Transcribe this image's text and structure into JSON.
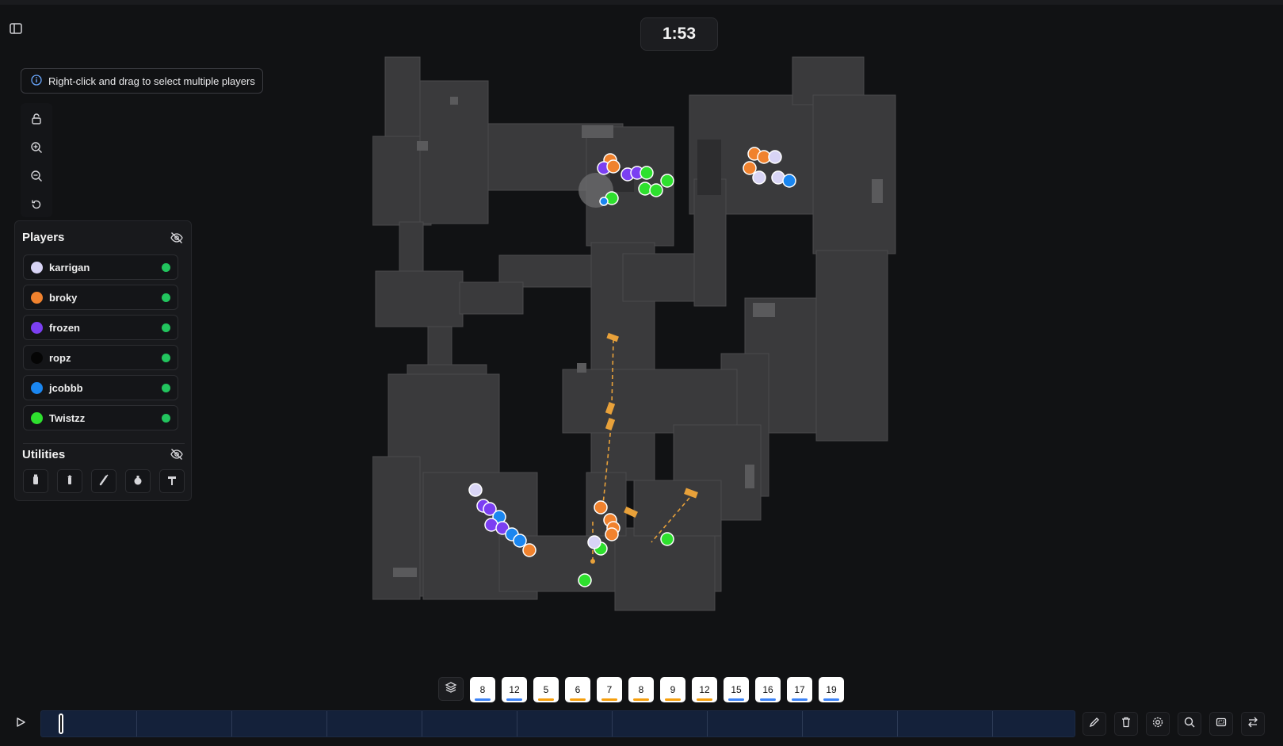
{
  "timer": "1:53",
  "hint": {
    "icon": "info-icon",
    "text": "Right-click and drag to select multiple players"
  },
  "tools": [
    "unlock-icon",
    "zoom-in-icon",
    "zoom-out-icon",
    "reset-icon"
  ],
  "players_panel": {
    "title": "Players",
    "items": [
      {
        "name": "karrigan",
        "color": "#d8d4f5"
      },
      {
        "name": "broky",
        "color": "#f0822e"
      },
      {
        "name": "frozen",
        "color": "#7b3ff2"
      },
      {
        "name": "ropz",
        "color": "#050505"
      },
      {
        "name": "jcobbb",
        "color": "#1a86f0"
      },
      {
        "name": "Twistzz",
        "color": "#2ee02e"
      }
    ],
    "status_color": "#22c55e"
  },
  "utilities_panel": {
    "title": "Utilities",
    "items": [
      "smoke-grenade-icon",
      "flashbang-icon",
      "molotov-icon",
      "he-grenade-icon",
      "decoy-icon"
    ]
  },
  "rounds": [
    {
      "label": "8",
      "bar": "#3b82f6"
    },
    {
      "label": "12",
      "bar": "#3b82f6"
    },
    {
      "label": "5",
      "bar": "#f59e0b"
    },
    {
      "label": "6",
      "bar": "#f59e0b"
    },
    {
      "label": "7",
      "bar": "#f59e0b"
    },
    {
      "label": "8",
      "bar": "#f59e0b"
    },
    {
      "label": "9",
      "bar": "#f59e0b"
    },
    {
      "label": "12",
      "bar": "#f59e0b"
    },
    {
      "label": "15",
      "bar": "#3b82f6"
    },
    {
      "label": "16",
      "bar": "#3b82f6"
    },
    {
      "label": "17",
      "bar": "#3b82f6"
    },
    {
      "label": "19",
      "bar": "#3b82f6"
    }
  ],
  "bottom_tools": [
    "pencil-icon",
    "trash-icon",
    "settings-icon",
    "search-icon",
    "selection-icon",
    "swap-icon"
  ]
}
